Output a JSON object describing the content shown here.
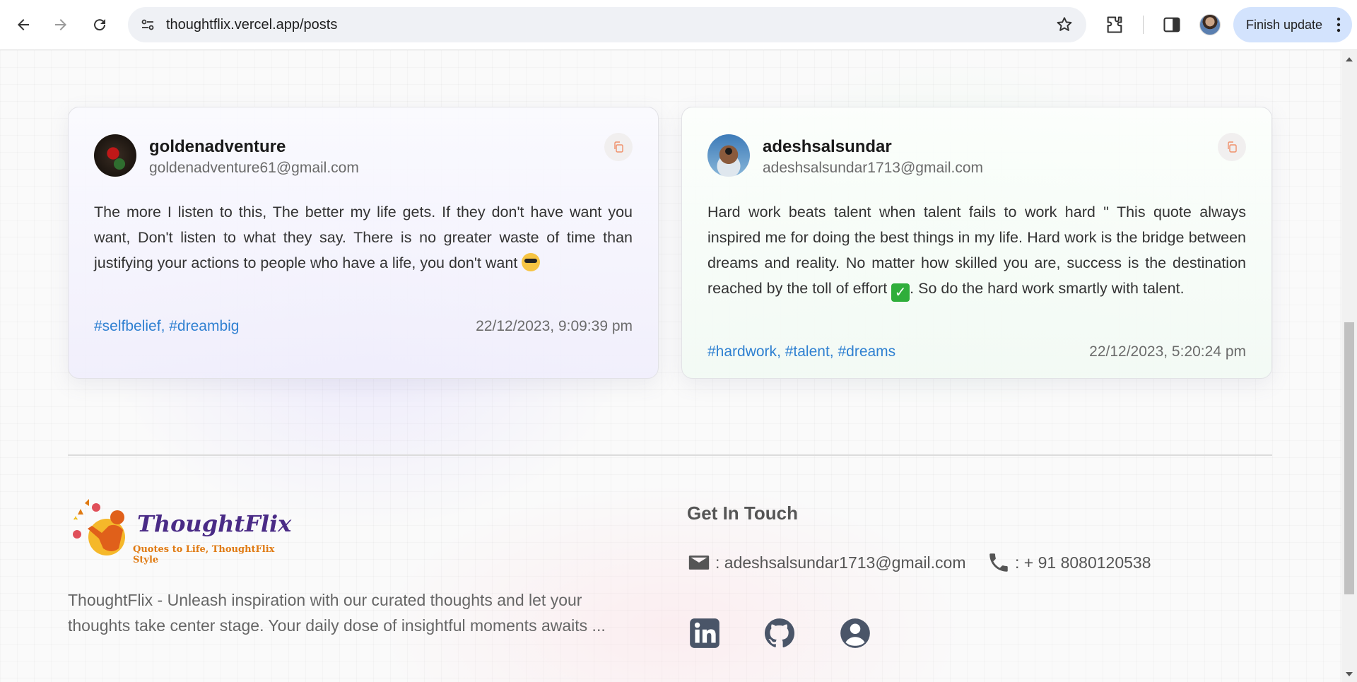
{
  "browser": {
    "url": "thoughtflix.vercel.app/posts",
    "finish_update_label": "Finish update"
  },
  "posts": [
    {
      "username": "goldenadventure",
      "email": "goldenadventure61@gmail.com",
      "quote": "The more I listen to this, The better my life gets. If they don't have want you want, Don't listen to what they say. There is no greater waste of time than justifying your actions to people who have a life, you don't want",
      "emoji": "sunglasses-face",
      "tags": [
        "#selfbelief",
        "#dreambig"
      ],
      "date": "22/12/2023, 9:09:39 pm"
    },
    {
      "username": "adeshsalsundar",
      "email": "adeshsalsundar1713@gmail.com",
      "quote_part1": "Hard work beats talent when talent fails to work hard \" This quote always inspired me for doing the best things in my life. Hard work is the bridge between dreams and reality. No matter how skilled you are, success is the destination reached by the toll of effort",
      "quote_part2": ". So do the hard work smartly with talent.",
      "emoji": "check-mark-button",
      "tags": [
        "#hardwork",
        "#talent",
        "#dreams"
      ],
      "date": "22/12/2023, 5:20:24 pm"
    }
  ],
  "footer": {
    "logo_brand": "ThoughtFlix",
    "logo_tagline": "Quotes to Life, ThoughtFlix Style",
    "about": "ThoughtFlix - Unleash inspiration with our curated thoughts and let your thoughts take center stage. Your daily dose of insightful moments awaits ...",
    "contact_title": "Get In Touch",
    "contact_email": ": adeshsalsundar1713@gmail.com",
    "contact_phone": ": + 91 8080120538"
  },
  "colors": {
    "accent": "#2f80d1",
    "logo_purple": "#4a2b86",
    "logo_orange": "#e07a12"
  }
}
